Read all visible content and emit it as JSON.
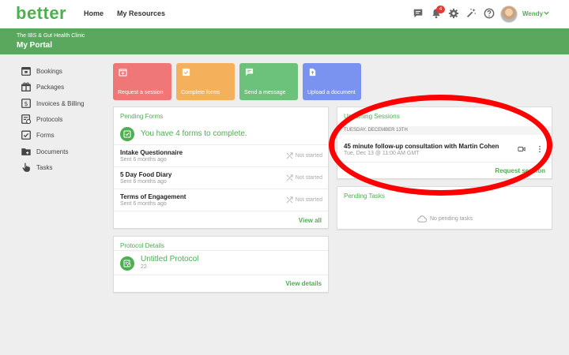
{
  "app": {
    "logo": "better"
  },
  "nav": {
    "home": "Home",
    "resources": "My Resources"
  },
  "top_icons": [
    "chat-icon",
    "bell-icon",
    "gear-icon",
    "magic-wand-icon",
    "help-icon"
  ],
  "notifications": {
    "count": "4"
  },
  "user": {
    "name": "Wendy"
  },
  "header": {
    "clinic": "The IBS & Gut Health Clinic",
    "portal": "My Portal"
  },
  "sidebar": {
    "items": [
      {
        "label": "Bookings",
        "icon": "calendar-icon"
      },
      {
        "label": "Packages",
        "icon": "gift-icon"
      },
      {
        "label": "Invoices & Billing",
        "icon": "dollar-icon"
      },
      {
        "label": "Protocols",
        "icon": "protocol-icon"
      },
      {
        "label": "Forms",
        "icon": "checkbox-icon"
      },
      {
        "label": "Documents",
        "icon": "folder-icon"
      },
      {
        "label": "Tasks",
        "icon": "hand-pointer-icon"
      }
    ]
  },
  "tiles": [
    {
      "label": "Request a session",
      "color": "#ef7777",
      "icon": "calendar-add-icon"
    },
    {
      "label": "Complete forms",
      "color": "#f4b05a",
      "icon": "checkbox-icon"
    },
    {
      "label": "Send a message",
      "color": "#6cc27a",
      "icon": "message-icon"
    },
    {
      "label": "Upload a document",
      "color": "#7b93f0",
      "icon": "document-icon"
    }
  ],
  "pending_forms": {
    "title": "Pending Forms",
    "summary": "You have 4 forms to complete.",
    "forms": [
      {
        "name": "Intake Questionnaire",
        "sent": "Sent 6 months ago",
        "status": "Not started"
      },
      {
        "name": "5 Day Food Diary",
        "sent": "Sent 6 months ago",
        "status": "Not started"
      },
      {
        "name": "Terms of Engagement",
        "sent": "Sent 6 months ago",
        "status": "Not started"
      }
    ],
    "view_all": "View all"
  },
  "upcoming_sessions": {
    "title": "Upcoming Sessions",
    "date_header": "TUESDAY, DECEMBER 13TH",
    "session_title": "45 minute follow-up consultation with Martin Cohen",
    "session_time": "Tue, Dec 13 @ 11:00 AM GMT",
    "request_link": "Request session"
  },
  "pending_tasks": {
    "title": "Pending Tasks",
    "empty": "No pending tasks"
  },
  "protocol": {
    "title": "Protocol Details",
    "name": "Untitled Protocol",
    "count": "22",
    "view_details": "View details"
  },
  "colors": {
    "brand": "#4caf50",
    "header": "#5aa85e",
    "annotation": "#ff0000",
    "badge": "#e53935"
  }
}
